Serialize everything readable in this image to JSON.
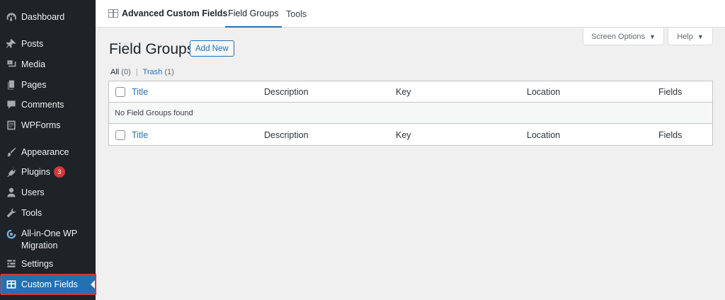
{
  "sidebar": {
    "items": [
      {
        "id": "dashboard",
        "label": "Dashboard",
        "icon": "dashboard-icon"
      },
      {
        "id": "posts",
        "label": "Posts",
        "icon": "pin-icon"
      },
      {
        "id": "media",
        "label": "Media",
        "icon": "media-icon"
      },
      {
        "id": "pages",
        "label": "Pages",
        "icon": "pages-icon"
      },
      {
        "id": "comments",
        "label": "Comments",
        "icon": "comment-icon"
      },
      {
        "id": "wpforms",
        "label": "WPForms",
        "icon": "form-icon"
      },
      {
        "id": "appearance",
        "label": "Appearance",
        "icon": "brush-icon"
      },
      {
        "id": "plugins",
        "label": "Plugins",
        "icon": "plugin-icon",
        "badge": "3"
      },
      {
        "id": "users",
        "label": "Users",
        "icon": "user-icon"
      },
      {
        "id": "tools",
        "label": "Tools",
        "icon": "wrench-icon"
      },
      {
        "id": "migration",
        "label": "All-in-One WP Migration",
        "icon": "migration-icon"
      },
      {
        "id": "settings",
        "label": "Settings",
        "icon": "settings-icon"
      },
      {
        "id": "custom_fields",
        "label": "Custom Fields",
        "icon": "table-icon",
        "active": true
      }
    ]
  },
  "topbar": {
    "brand": "Advanced Custom Fields",
    "tabs": [
      {
        "label": "Field Groups",
        "active": true
      },
      {
        "label": "Tools",
        "active": false
      }
    ]
  },
  "screen_meta": {
    "screen_options": "Screen Options",
    "help": "Help",
    "caret": "▼"
  },
  "page": {
    "title": "Field Groups",
    "add_new": "Add New"
  },
  "filters": {
    "all_label": "All",
    "all_count": "(0)",
    "separator": "|",
    "trash_label": "Trash",
    "trash_count": "(1)"
  },
  "table": {
    "columns": [
      "Title",
      "Description",
      "Key",
      "Location",
      "Fields"
    ],
    "empty_message": "No Field Groups found"
  },
  "colors": {
    "sidebar_bg": "#1d2327",
    "accent": "#2271b1",
    "badge": "#d63638",
    "background": "#f0f0f1"
  }
}
